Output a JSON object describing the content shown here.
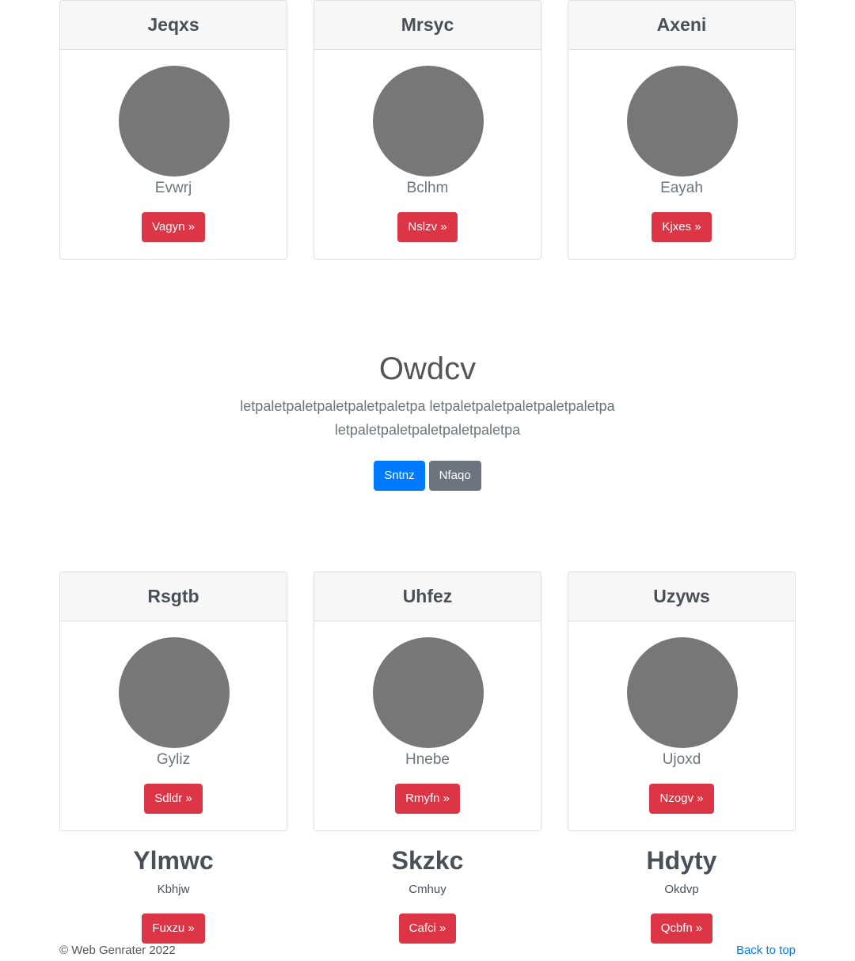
{
  "top_cards": [
    {
      "title": "Jeqxs",
      "subtitle": "Evwrj",
      "button": "Vagyn »"
    },
    {
      "title": "Mrsyc",
      "subtitle": "Bclhm",
      "button": "Nslzv »"
    },
    {
      "title": "Axeni",
      "subtitle": "Eayah",
      "button": "Kjxes »"
    }
  ],
  "hero": {
    "title": "Owdcv",
    "text": "letpaletpaletpaletpaletpaletpa letpaletpaletpaletpaletpaletpa letpaletpaletpaletpaletpaletpa",
    "primary_button": "Sntnz",
    "secondary_button": "Nfaqo"
  },
  "bottom_cards": [
    {
      "title": "Rsgtb",
      "subtitle": "Gyliz",
      "button": "Sdldr »"
    },
    {
      "title": "Uhfez",
      "subtitle": "Hnebe",
      "button": "Rmyfn »"
    },
    {
      "title": "Uzyws",
      "subtitle": "Ujoxd",
      "button": "Nzogv »"
    }
  ],
  "features": [
    {
      "title": "Ylmwc",
      "subtitle": "Kbhjw",
      "button": "Fuxzu »"
    },
    {
      "title": "Skzkc",
      "subtitle": "Cmhuy",
      "button": "Cafci »"
    },
    {
      "title": "Hdyty",
      "subtitle": "Okdvp",
      "button": "Qcbfn »"
    }
  ],
  "footer": {
    "copyright": "© Web Genrater 2022",
    "back_to_top": "Back to top"
  },
  "colors": {
    "danger": "#dc3545",
    "primary": "#007bff",
    "secondary": "#6c757d",
    "avatar": "#777777"
  }
}
